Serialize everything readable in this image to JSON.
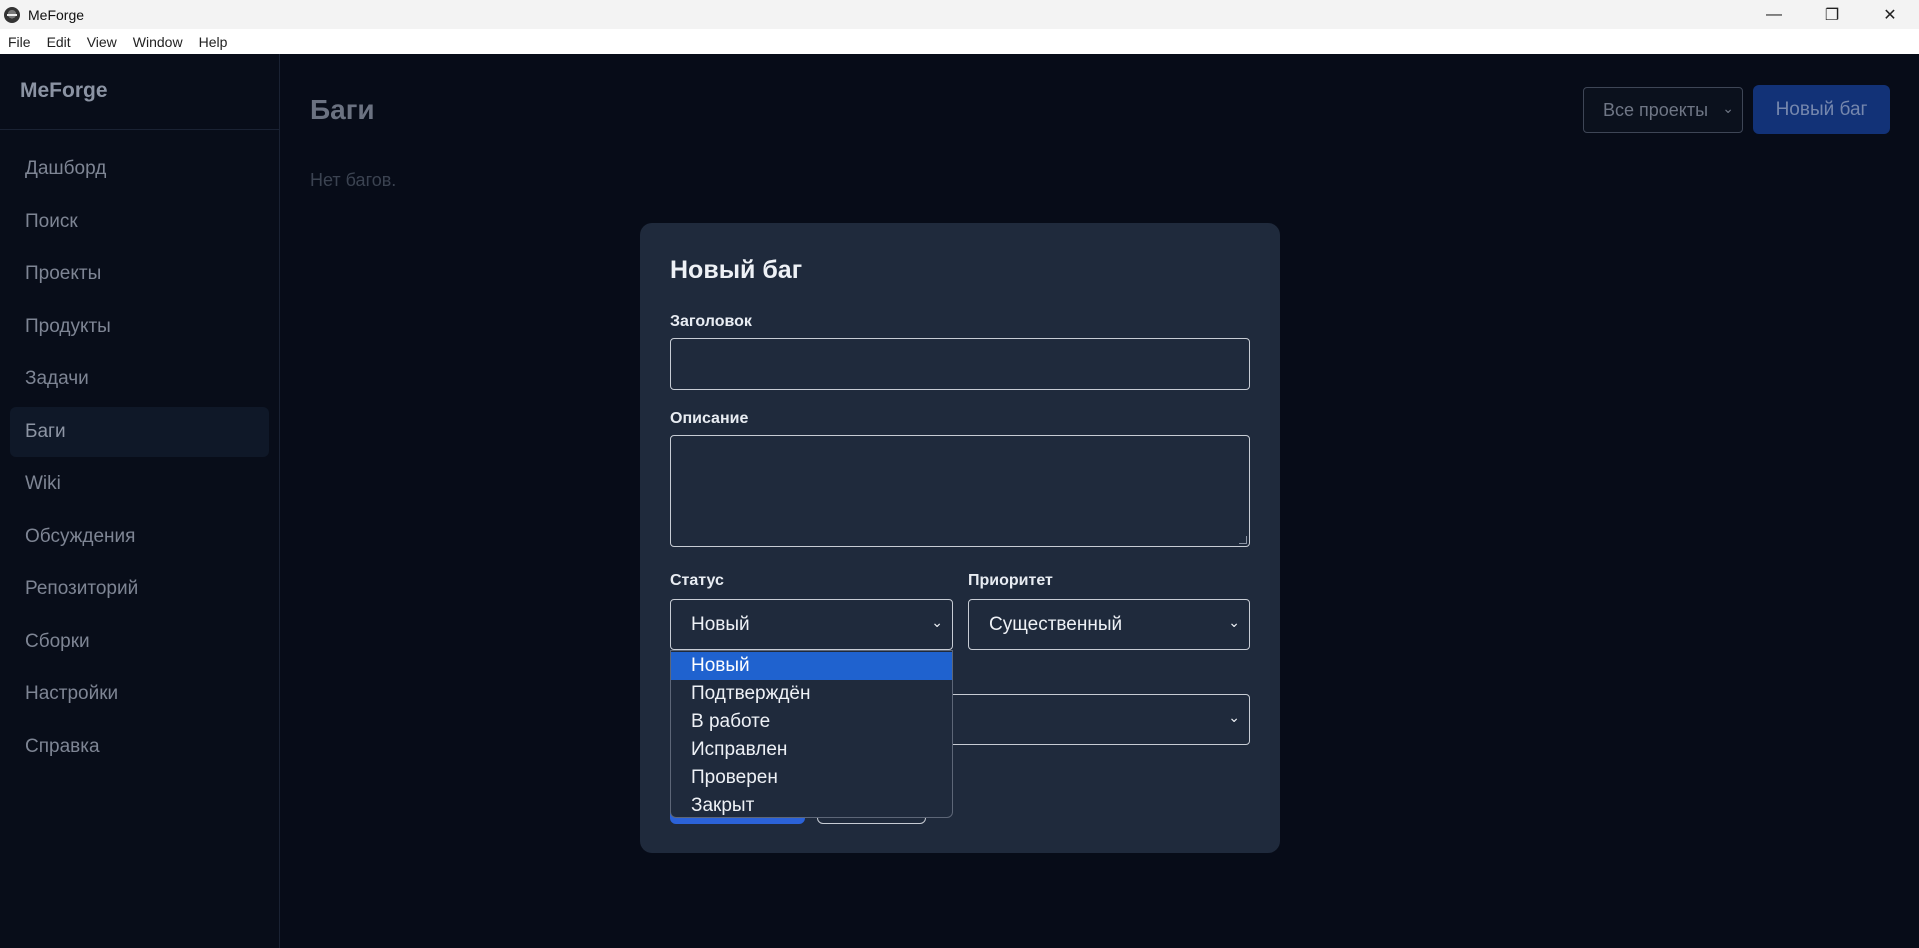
{
  "window": {
    "title": "MeForge",
    "controls": {
      "minimize": "—",
      "restore": "❐",
      "close": "✕"
    }
  },
  "menu": [
    "File",
    "Edit",
    "View",
    "Window",
    "Help"
  ],
  "sidebar": {
    "brand": "MeForge",
    "items": [
      {
        "label": "Дашборд",
        "active": false
      },
      {
        "label": "Поиск",
        "active": false
      },
      {
        "label": "Проекты",
        "active": false
      },
      {
        "label": "Продукты",
        "active": false
      },
      {
        "label": "Задачи",
        "active": false
      },
      {
        "label": "Баги",
        "active": true
      },
      {
        "label": "Wiki",
        "active": false
      },
      {
        "label": "Обсуждения",
        "active": false
      },
      {
        "label": "Репозиторий",
        "active": false
      },
      {
        "label": "Сборки",
        "active": false
      },
      {
        "label": "Настройки",
        "active": false
      },
      {
        "label": "Справка",
        "active": false
      }
    ]
  },
  "main": {
    "title": "Баги",
    "empty_text": "Нет багов.",
    "project_filter": "Все проекты",
    "new_bug_button": "Новый баг"
  },
  "modal": {
    "title": "Новый баг",
    "title_label": "Заголовок",
    "title_value": "",
    "description_label": "Описание",
    "description_value": "",
    "status_label": "Статус",
    "status_value": "Новый",
    "priority_label": "Приоритет",
    "priority_value": "Существенный",
    "third_select_value": ""
  },
  "status_dropdown": {
    "options": [
      "Новый",
      "Подтверждён",
      "В работе",
      "Исправлен",
      "Проверен",
      "Закрыт"
    ],
    "selected": "Новый"
  },
  "icons": {
    "chevron": "⌄"
  },
  "colors": {
    "accent": "#2b62d8",
    "dropdown_highlight": "#1f62cf",
    "modal_bg": "#1f2a3c",
    "app_bg": "#070c18"
  }
}
